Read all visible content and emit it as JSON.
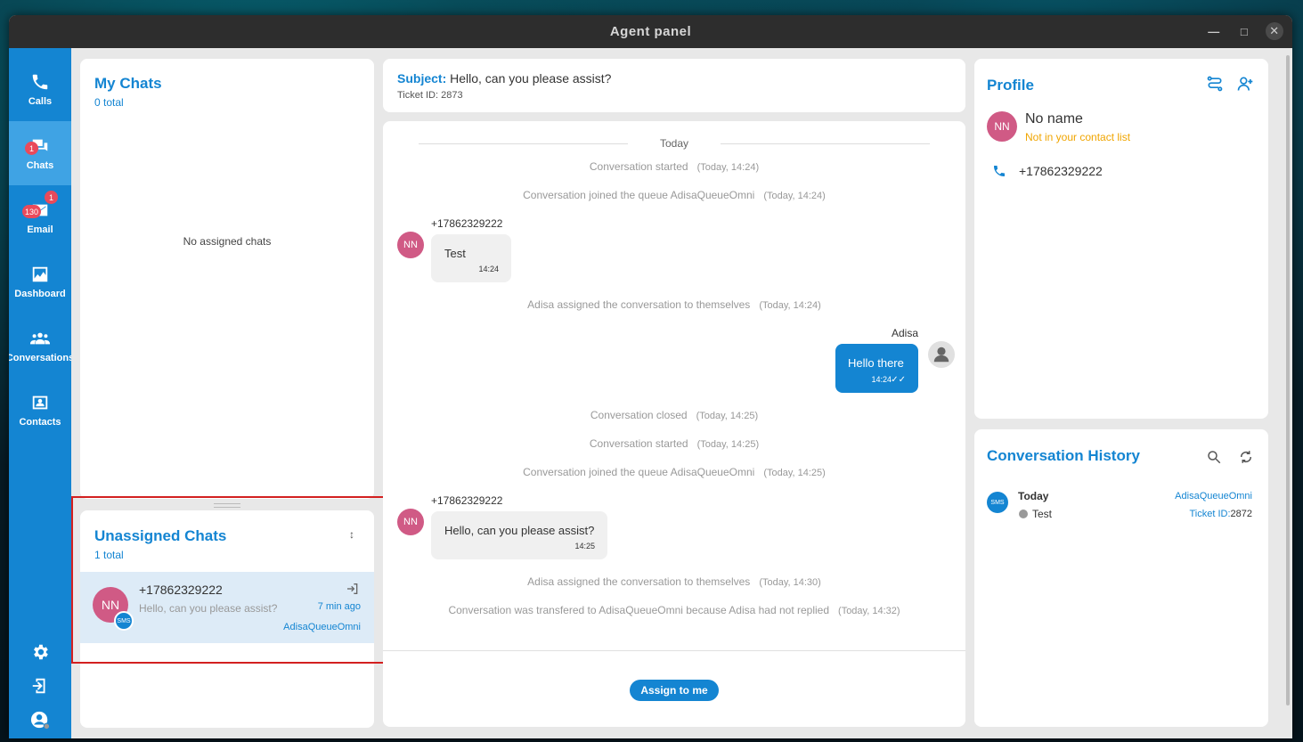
{
  "window": {
    "title": "Agent panel"
  },
  "sidebar": {
    "items": [
      {
        "label": "Calls"
      },
      {
        "label": "Chats",
        "badge": "1"
      },
      {
        "label": "Email",
        "badge": "1",
        "badge2": "130"
      },
      {
        "label": "Dashboard"
      },
      {
        "label": "Conversations"
      },
      {
        "label": "Contacts"
      }
    ]
  },
  "my_chats": {
    "title": "My Chats",
    "count": "0 total",
    "empty": "No assigned chats"
  },
  "unassigned": {
    "title": "Unassigned Chats",
    "count": "1 total",
    "item": {
      "initials": "NN",
      "name": "+17862329222",
      "preview": "Hello, can you please assist?",
      "time": "7 min ago",
      "queue": "AdisaQueueOmni",
      "channel": "SMS"
    }
  },
  "subject": {
    "label": "Subject:",
    "text": "Hello, can you please assist?",
    "ticket": "Ticket ID: 2873"
  },
  "conversation": {
    "day": "Today",
    "events": [
      {
        "text": "Conversation started",
        "ts": "(Today, 14:24)"
      },
      {
        "text": "Conversation joined the queue AdisaQueueOmni",
        "ts": "(Today, 14:24)"
      },
      {
        "text": "Adisa assigned the conversation to themselves",
        "ts": "(Today, 14:24)"
      },
      {
        "text": "Conversation closed",
        "ts": "(Today, 14:25)"
      },
      {
        "text": "Conversation started",
        "ts": "(Today, 14:25)"
      },
      {
        "text": "Conversation joined the queue AdisaQueueOmni",
        "ts": "(Today, 14:25)"
      },
      {
        "text": "Adisa assigned the conversation to themselves",
        "ts": "(Today, 14:30)"
      },
      {
        "text": "Conversation was transfered to AdisaQueueOmni because Adisa had not replied",
        "ts": "(Today, 14:32)"
      }
    ],
    "messages": [
      {
        "sender": "+17862329222",
        "initials": "NN",
        "text": "Test",
        "time": "14:24"
      },
      {
        "sender": "Adisa",
        "text": "Hello there",
        "time": "14:24"
      },
      {
        "sender": "+17862329222",
        "initials": "NN",
        "text": "Hello, can you please assist?",
        "time": "14:25"
      }
    ],
    "assign_label": "Assign to me"
  },
  "profile": {
    "title": "Profile",
    "initials": "NN",
    "name": "No name",
    "note": "Not in your contact list",
    "phone": "+17862329222"
  },
  "history": {
    "title": "Conversation History",
    "channel": "SMS",
    "day": "Today",
    "message": "Test",
    "queue": "AdisaQueueOmni",
    "ticket_label": "Ticket ID:",
    "ticket_value": "2872"
  },
  "colors": {
    "accent": "#1485d2",
    "avatar": "#d05a85",
    "badge": "#e94a5b",
    "warning": "#f0a500",
    "highlight": "#d32020"
  }
}
